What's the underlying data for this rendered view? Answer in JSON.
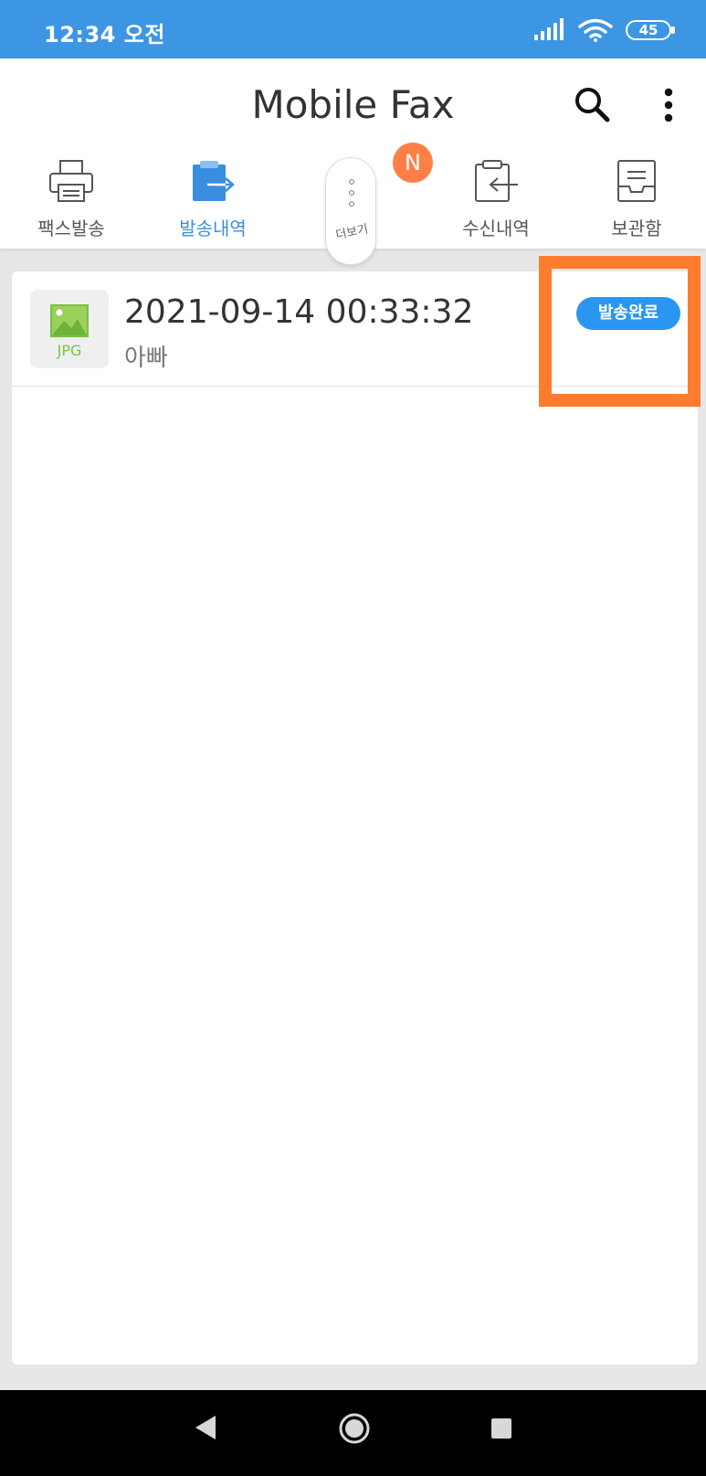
{
  "status_bar": {
    "time": "12:34 오전",
    "battery": "45"
  },
  "header": {
    "title": "Mobile Fax",
    "tabs": [
      {
        "label": "팩스발송",
        "icon": "printer-icon",
        "active": false
      },
      {
        "label": "발송내역",
        "icon": "sent-clipboard-icon",
        "active": true
      },
      {
        "label": "수신내역",
        "icon": "received-clipboard-icon",
        "active": false
      },
      {
        "label": "보관함",
        "icon": "archive-box-icon",
        "active": false
      }
    ],
    "more_label": "더보기",
    "new_badge": "N"
  },
  "fax_list": [
    {
      "file_type": "JPG",
      "date": "2021-09-14 00:33:32",
      "recipient": "아빠",
      "status": "발송완료"
    }
  ],
  "colors": {
    "status_bar": "#3d96e3",
    "accent": "#3a8ee0",
    "badge": "#2a96f2",
    "new_badge": "#ff7f47",
    "highlight": "#ff7b2e"
  }
}
